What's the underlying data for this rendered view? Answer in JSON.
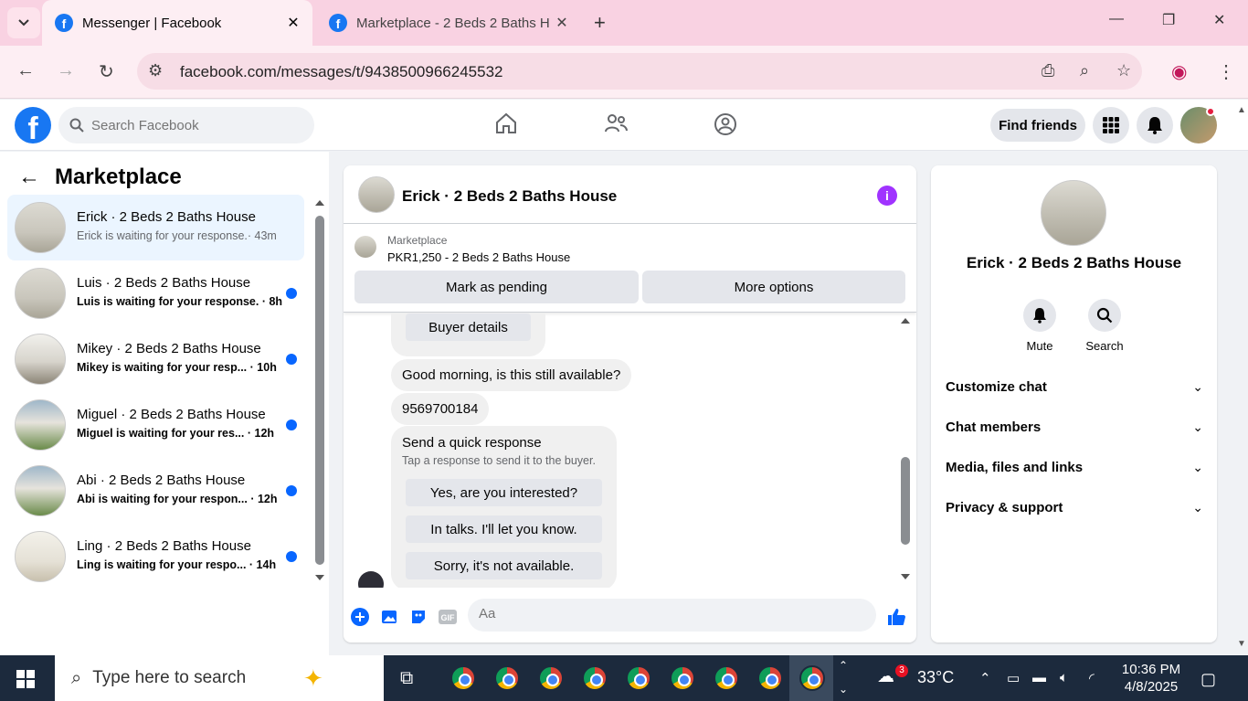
{
  "browser": {
    "tabs": [
      {
        "title": "Messenger | Facebook",
        "active": true
      },
      {
        "title": "Marketplace - 2 Beds 2 Baths H",
        "active": false
      }
    ],
    "url": "facebook.com/messages/t/9438500966245532"
  },
  "fb": {
    "search_placeholder": "Search Facebook",
    "find_friends": "Find friends"
  },
  "left": {
    "title": "Marketplace",
    "conversations": [
      {
        "name": "Erick · 2 Beds 2 Baths House",
        "preview": "Erick is waiting for your response.",
        "time": "· 43m",
        "unread": false
      },
      {
        "name": "Luis · 2 Beds 2 Baths House",
        "preview": "Luis is waiting for your response.",
        "time": "· 8h",
        "unread": true
      },
      {
        "name": "Mikey · 2 Beds 2 Baths House",
        "preview": "Mikey is waiting for your resp...",
        "time": "· 10h",
        "unread": true
      },
      {
        "name": "Miguel · 2 Beds 2 Baths House",
        "preview": "Miguel is waiting for your res...",
        "time": "· 12h",
        "unread": true
      },
      {
        "name": "Abi · 2 Beds 2 Baths House",
        "preview": "Abi is waiting for your respon...",
        "time": "· 12h",
        "unread": true
      },
      {
        "name": "Ling · 2 Beds 2 Baths House",
        "preview": "Ling is waiting for your respo...",
        "time": "· 14h",
        "unread": true
      }
    ]
  },
  "chat": {
    "title": "Erick · 2 Beds 2 Baths House",
    "listing_label": "Marketplace",
    "listing_price": "PKR1,250 - 2 Beds 2 Baths House",
    "mark_pending": "Mark as pending",
    "more_options": "More options",
    "buyer_details": "Buyer details",
    "msg1": "Good morning, is this still available?",
    "msg2": "9569700184",
    "quick_title": "Send a quick response",
    "quick_sub": "Tap a response to send it to the buyer.",
    "quick_responses": [
      "Yes, are you interested?",
      "In talks. I'll let you know.",
      "Sorry, it's not available."
    ],
    "composer_placeholder": "Aa"
  },
  "details": {
    "name": "Erick · 2 Beds 2 Baths House",
    "mute": "Mute",
    "search": "Search",
    "sections": [
      "Customize chat",
      "Chat members",
      "Media, files and links",
      "Privacy & support"
    ]
  },
  "taskbar": {
    "search_placeholder": "Type here to search",
    "temperature": "33°C",
    "notification_count": "3",
    "time": "10:36 PM",
    "date": "4/8/2025"
  },
  "colors": {
    "facebook_blue": "#1877f2",
    "messenger_blue": "#0866ff",
    "unread_dot": "#0866ff",
    "info_purple": "#a033ff",
    "chrome_tab_bg": "#f9d2e2"
  }
}
